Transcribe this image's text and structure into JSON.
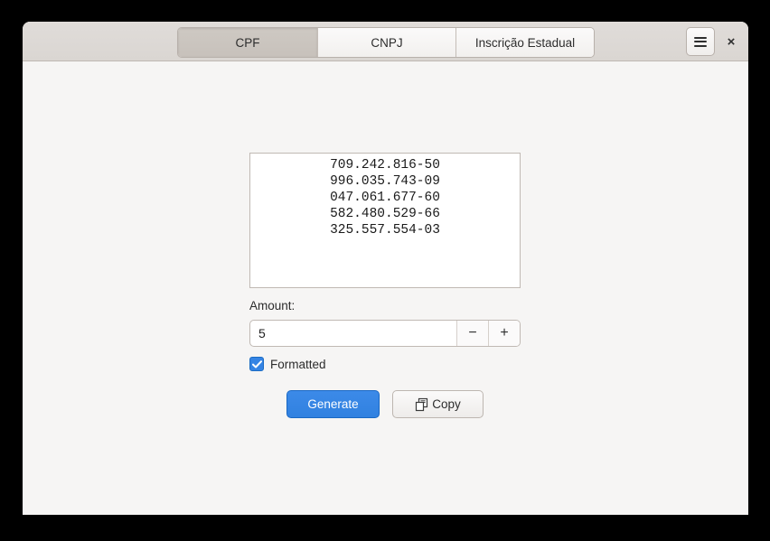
{
  "window": {
    "tabs": [
      {
        "id": "cpf",
        "label": "CPF",
        "active": true
      },
      {
        "id": "cnpj",
        "label": "CNPJ",
        "active": false
      },
      {
        "id": "ie",
        "label": "Inscrição Estadual",
        "active": false
      }
    ],
    "menu_button_icon": "hamburger-icon",
    "close_button_label": "×"
  },
  "main": {
    "output": {
      "lines": [
        "709.242.816-50",
        "996.035.743-09",
        "047.061.677-60",
        "582.480.529-66",
        "325.557.554-03"
      ]
    },
    "amount": {
      "label": "Amount:",
      "value": "5",
      "decrement_label": "−",
      "increment_label": "+"
    },
    "formatted": {
      "label": "Formatted",
      "checked": true
    },
    "actions": {
      "generate_label": "Generate",
      "copy_label": "Copy",
      "copy_icon": "copy-icon"
    }
  },
  "colors": {
    "accent": "#3584e4",
    "header_bg": "#dad6d2",
    "body_bg": "#f6f5f4",
    "active_tab_bg": "#c9c4bf"
  }
}
